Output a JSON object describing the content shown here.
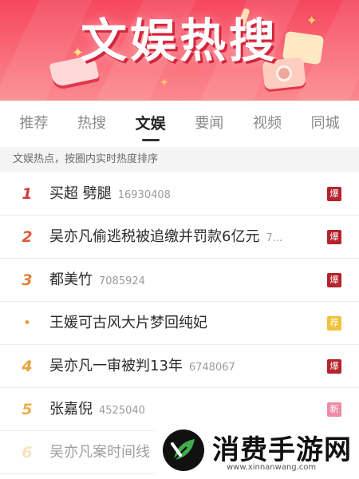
{
  "banner": {
    "title": "文娱热搜",
    "colors": {
      "top": "#f6475f",
      "bottom": "#fb8a8e"
    }
  },
  "tabs": [
    {
      "label": "推荐",
      "active": false
    },
    {
      "label": "热搜",
      "active": false
    },
    {
      "label": "文娱",
      "active": true
    },
    {
      "label": "要闻",
      "active": false
    },
    {
      "label": "视频",
      "active": false
    },
    {
      "label": "同城",
      "active": false
    }
  ],
  "section_hint": "文娱热点，按圈内实时热度排序",
  "rows": [
    {
      "rank": "1",
      "rank_color": "#d23c3c",
      "title": "买超 劈腿",
      "count": "16930408",
      "badge": "爆",
      "badge_color": "#b4242e"
    },
    {
      "rank": "2",
      "rank_color": "#e05a3c",
      "title": "吴亦凡偷逃税被追缴并罚款6亿元",
      "count": "7...",
      "badge": "爆",
      "badge_color": "#b4242e"
    },
    {
      "rank": "3",
      "rank_color": "#e8803a",
      "title": "都美竹",
      "count": "7085924",
      "badge": "爆",
      "badge_color": "#b4242e"
    },
    {
      "rank": "•",
      "rank_color": "#e8a23a",
      "title": "王媛可古风大片梦回纯妃",
      "count": "",
      "badge": "荐",
      "badge_color": "#f0c13c"
    },
    {
      "rank": "4",
      "rank_color": "#e8a23a",
      "title": "吴亦凡一审被判13年",
      "count": "6748067",
      "badge": "爆",
      "badge_color": "#b4242e"
    },
    {
      "rank": "5",
      "rank_color": "#eab04a",
      "title": "张嘉倪",
      "count": "4525040",
      "badge": "新",
      "badge_color": "#ef8aa6"
    },
    {
      "rank": "6",
      "rank_color": "#eec070",
      "title": "吴亦凡案时间线",
      "count": "",
      "badge": "",
      "badge_color": "#ffffff"
    }
  ],
  "watermark": {
    "text": "消费手游网",
    "url": "www.xinnanwang.com"
  },
  "icons": [
    "book-icon",
    "camera-icon",
    "star-icon",
    "leaf-logo-icon"
  ]
}
